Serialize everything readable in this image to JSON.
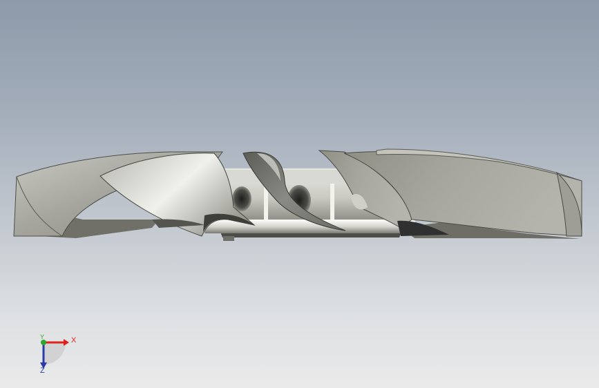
{
  "viewport": {
    "background_top": "#8e9aaa",
    "background_bottom": "#eaeaea"
  },
  "model": {
    "name": "fan-impeller"
  },
  "triad": {
    "x_label": "X",
    "y_label": "Y",
    "z_label": "Z",
    "x_color": "#e0201c",
    "y_color": "#2fa52c",
    "z_color": "#2a3aa8"
  }
}
